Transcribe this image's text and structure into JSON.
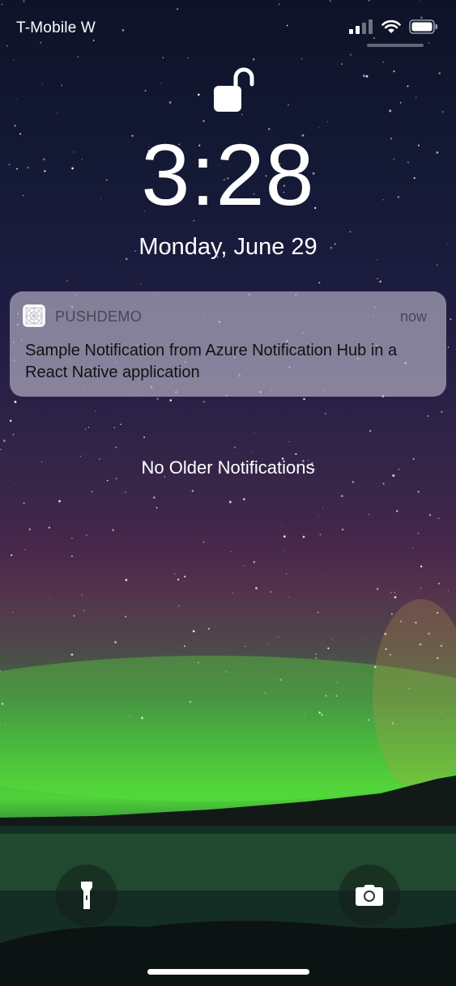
{
  "status_bar": {
    "carrier": "T-Mobile W",
    "signal_icon": "cellular-signal-icon",
    "wifi_icon": "wifi-icon",
    "battery_icon": "battery-icon"
  },
  "lock_screen": {
    "lock_icon": "unlocked-padlock-icon",
    "time": "3:28",
    "date": "Monday, June 29"
  },
  "notification": {
    "app_icon": "app-icon",
    "app_name": "PUSHDEMO",
    "time": "now",
    "body": "Sample Notification from Azure Notification Hub in a React Native application"
  },
  "no_older_text": "No Older Notifications",
  "bottom_controls": {
    "flashlight_icon": "flashlight-icon",
    "camera_icon": "camera-icon"
  },
  "colors": {
    "notification_bg": "#c3bed2",
    "text": "#ffffff"
  }
}
